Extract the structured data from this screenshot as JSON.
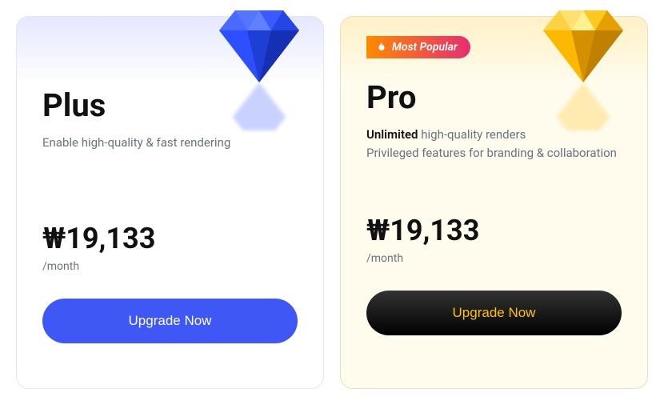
{
  "plans": {
    "plus": {
      "title": "Plus",
      "description": "Enable high-quality & fast rendering",
      "price": "₩19,133",
      "period": "/month",
      "cta_label": "Upgrade Now"
    },
    "pro": {
      "badge": "Most Popular",
      "title": "Pro",
      "desc_bold": "Unlimited",
      "desc_rest": " high-quality renders",
      "desc_line2": "Privileged features for branding & collaboration",
      "price": "₩19,133",
      "period": "/month",
      "cta_label": "Upgrade Now"
    }
  },
  "colors": {
    "plus_accent": "#3e57f5",
    "pro_accent": "#ffc107",
    "gem_blue": "#2e4fff",
    "gem_gold": "#ffb800"
  }
}
